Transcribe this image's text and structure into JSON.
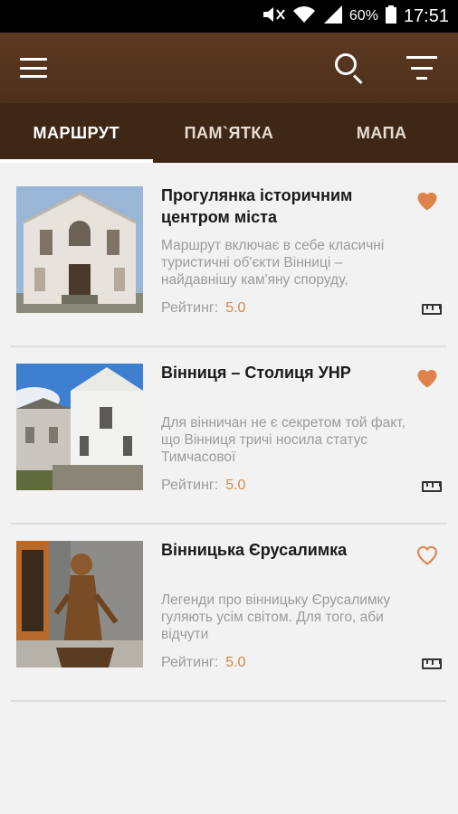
{
  "statusbar": {
    "battery": "60%",
    "time": "17:51"
  },
  "header": {
    "menu_icon": "menu-icon",
    "search_icon": "search-icon",
    "filter_icon": "filter-icon"
  },
  "tabs": [
    {
      "label": "МАРШРУТ",
      "active": true
    },
    {
      "label": "ПАМ`ЯТКА",
      "active": false
    },
    {
      "label": "МАПА",
      "active": false
    }
  ],
  "routes": [
    {
      "title": "Прогулянка історичним центром міста",
      "description": "Маршрут включає в себе класичні туристичні об'єкти Вінниці – найдавнішу кам'яну споруду,",
      "rating_label": "Рейтинг:",
      "rating_value": "5.0",
      "favorite": true
    },
    {
      "title": "Вінниця –  Столиця УНР",
      "description": "Для вінничан не є секретом той факт, що Вінниця тричі носила статус Тимчасової",
      "rating_label": "Рейтинг:",
      "rating_value": "5.0",
      "favorite": true
    },
    {
      "title": "Вінницька Єрусалимка",
      "description": "Легенди про вінницьку Єрусалимку гуляють усім світом. Для того, аби відчути",
      "rating_label": "Рейтинг:",
      "rating_value": "5.0",
      "favorite": false
    }
  ],
  "colors": {
    "appbar": "#5d3a22",
    "tabs": "#3f2716",
    "accent": "#e0834a",
    "rating": "#d4894a"
  }
}
